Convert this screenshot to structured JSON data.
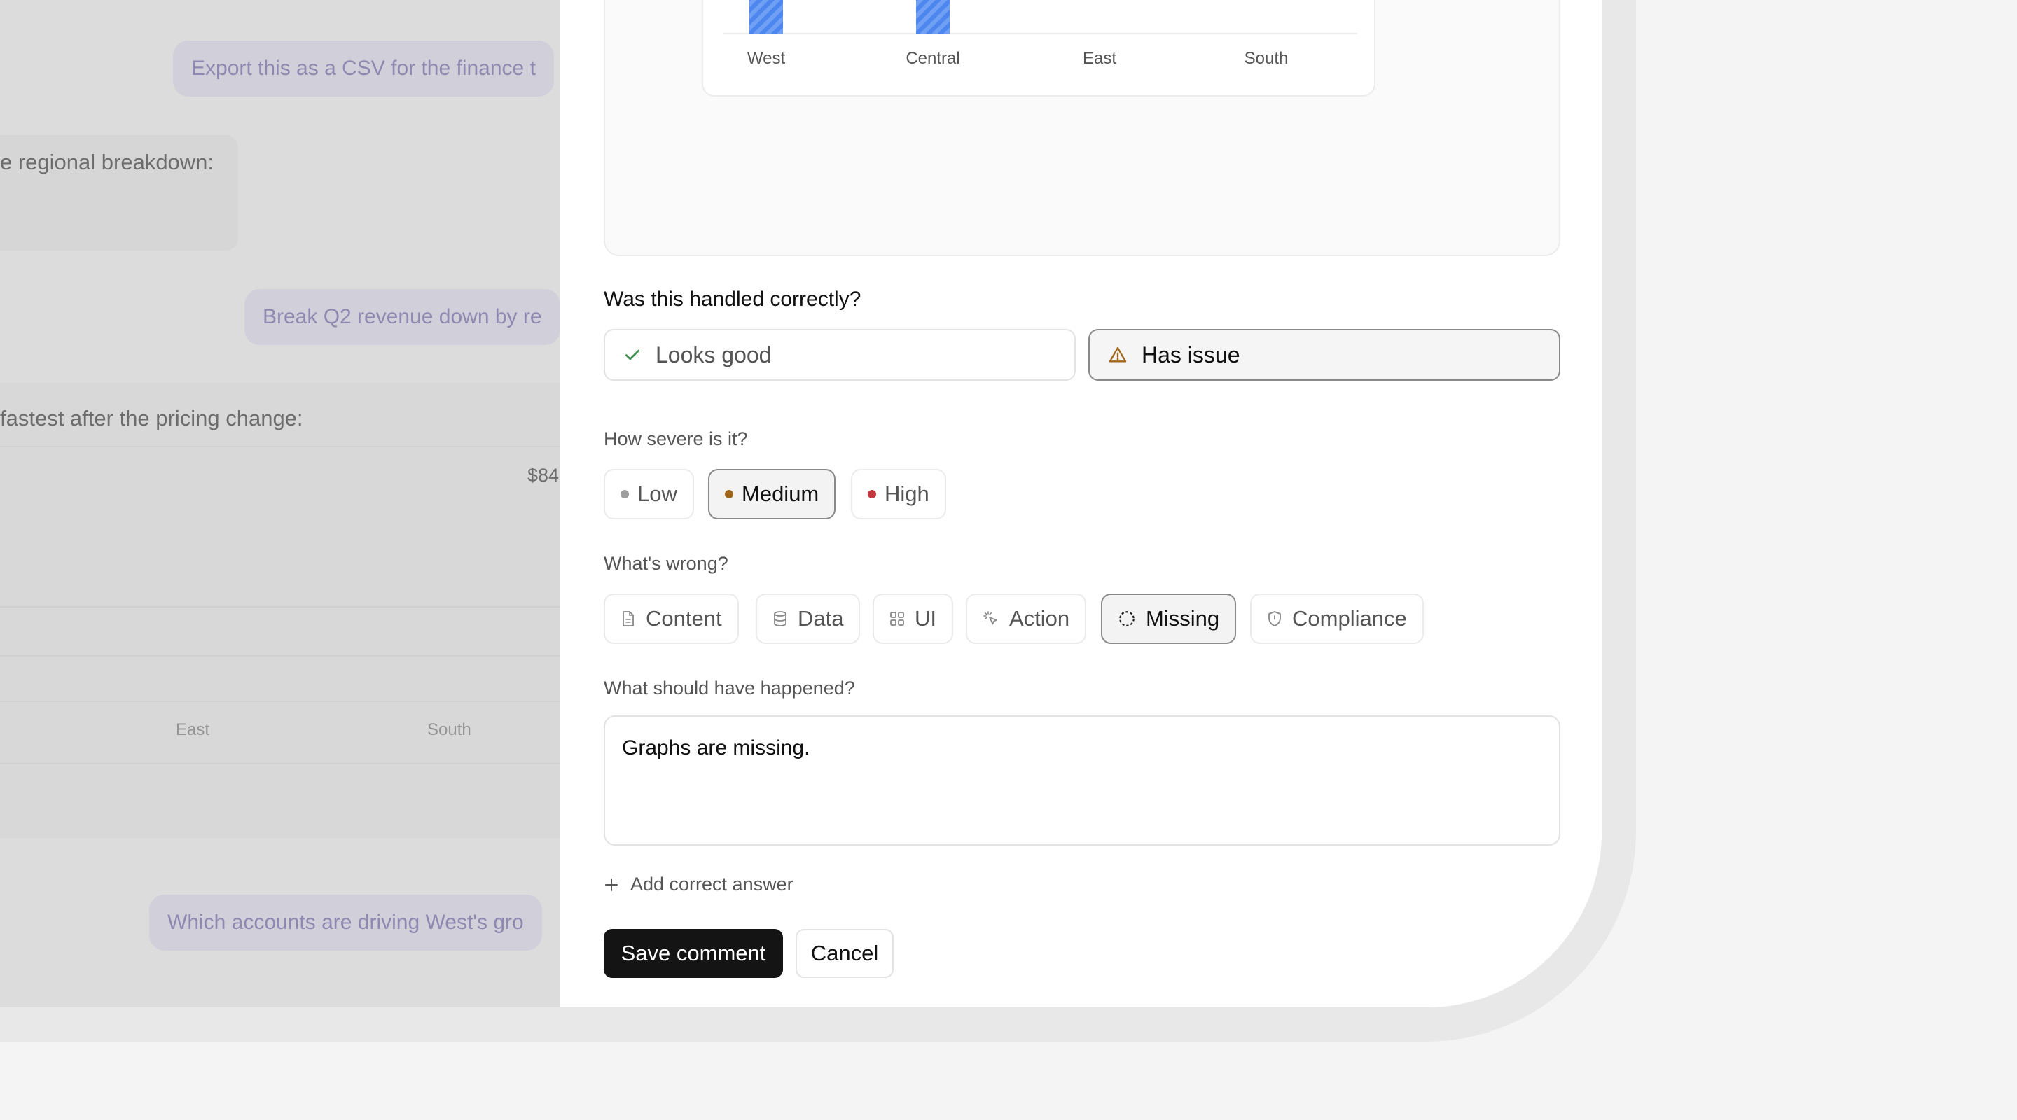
{
  "background_chat": {
    "messages": [
      {
        "text": "Export this as a CSV for the finance t"
      },
      {
        "text": "e regional breakdown:"
      },
      {
        "text": "Break Q2 revenue down by re"
      },
      {
        "text": "fastest after the pricing change:"
      },
      {
        "text": "$84"
      },
      {
        "text": "Which accounts are driving West's gro"
      }
    ],
    "chart_labels": [
      "East",
      "South"
    ]
  },
  "chart_data": {
    "type": "bar",
    "categories": [
      "West",
      "Central",
      "East",
      "South"
    ]
  },
  "feedback": {
    "question": "Was this handled correctly?",
    "choices": [
      {
        "label": "Looks good",
        "icon": "check-icon",
        "selected": false
      },
      {
        "label": "Has issue",
        "icon": "warning-icon",
        "selected": true
      }
    ],
    "severity": {
      "label": "How severe is it?",
      "options": [
        {
          "label": "Low",
          "color": "#9e9e9e",
          "selected": false
        },
        {
          "label": "Medium",
          "color": "#a0661a",
          "selected": true
        },
        {
          "label": "High",
          "color": "#c8363d",
          "selected": false
        }
      ]
    },
    "category": {
      "label": "What's wrong?",
      "options": [
        {
          "label": "Content",
          "icon": "document-icon",
          "selected": false
        },
        {
          "label": "Data",
          "icon": "database-icon",
          "selected": false
        },
        {
          "label": "UI",
          "icon": "grid-icon",
          "selected": false
        },
        {
          "label": "Action",
          "icon": "cursor-click-icon",
          "selected": false
        },
        {
          "label": "Missing",
          "icon": "dashed-circle-icon",
          "selected": true
        },
        {
          "label": "Compliance",
          "icon": "shield-icon",
          "selected": false
        }
      ]
    },
    "expected": {
      "label": "What should have happened?",
      "value": "Graphs are missing."
    },
    "add_correct_answer": "Add correct answer",
    "save_label": "Save comment",
    "cancel_label": "Cancel"
  }
}
